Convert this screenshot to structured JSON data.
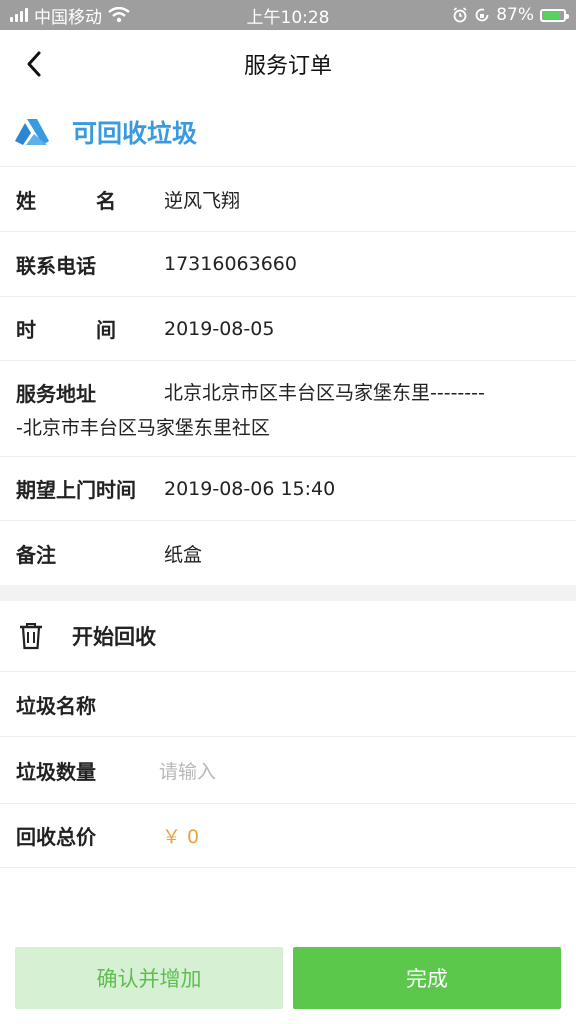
{
  "status_bar": {
    "carrier": "中国移动",
    "time": "上午10:28",
    "battery": "87%",
    "battery_level": 0.87,
    "icons": [
      "signal-icon",
      "wifi-icon",
      "alarm-icon",
      "orientation-lock-icon",
      "battery-icon"
    ]
  },
  "nav": {
    "title": "服务订单",
    "back_icon": "chevron-left-icon"
  },
  "category": {
    "title": "可回收垃圾",
    "icon": "recycle-triangle-icon",
    "accent": "#3a9ae0"
  },
  "order": {
    "name_label_1": "姓",
    "name_label_2": "名",
    "name_value": "逆风飞翔",
    "phone_label": "联系电话",
    "phone_value": "17316063660",
    "time_label_1": "时",
    "time_label_2": "间",
    "time_value": "2019-08-05",
    "address_label": "服务地址",
    "address_line1": "北京北京市区丰台区马家堡东里--------",
    "address_line2": "-北京市丰台区马家堡东里社区",
    "expected_label": "期望上门时间",
    "expected_value": "2019-08-06 15:40",
    "note_label": "备注",
    "note_value": "纸盒"
  },
  "recycle": {
    "title": "开始回收",
    "icon": "trash-icon",
    "name_label": "垃圾名称",
    "qty_label": "垃圾数量",
    "qty_placeholder": "请输入",
    "total_label": "回收总价",
    "total_value": "￥ 0"
  },
  "actions": {
    "confirm_add": "确认并增加",
    "finish": "完成"
  },
  "colors": {
    "primary_green": "#5cc84b",
    "light_green": "#d6f0d3",
    "price_orange": "#e8a33c",
    "link_blue": "#3a9ae0"
  }
}
